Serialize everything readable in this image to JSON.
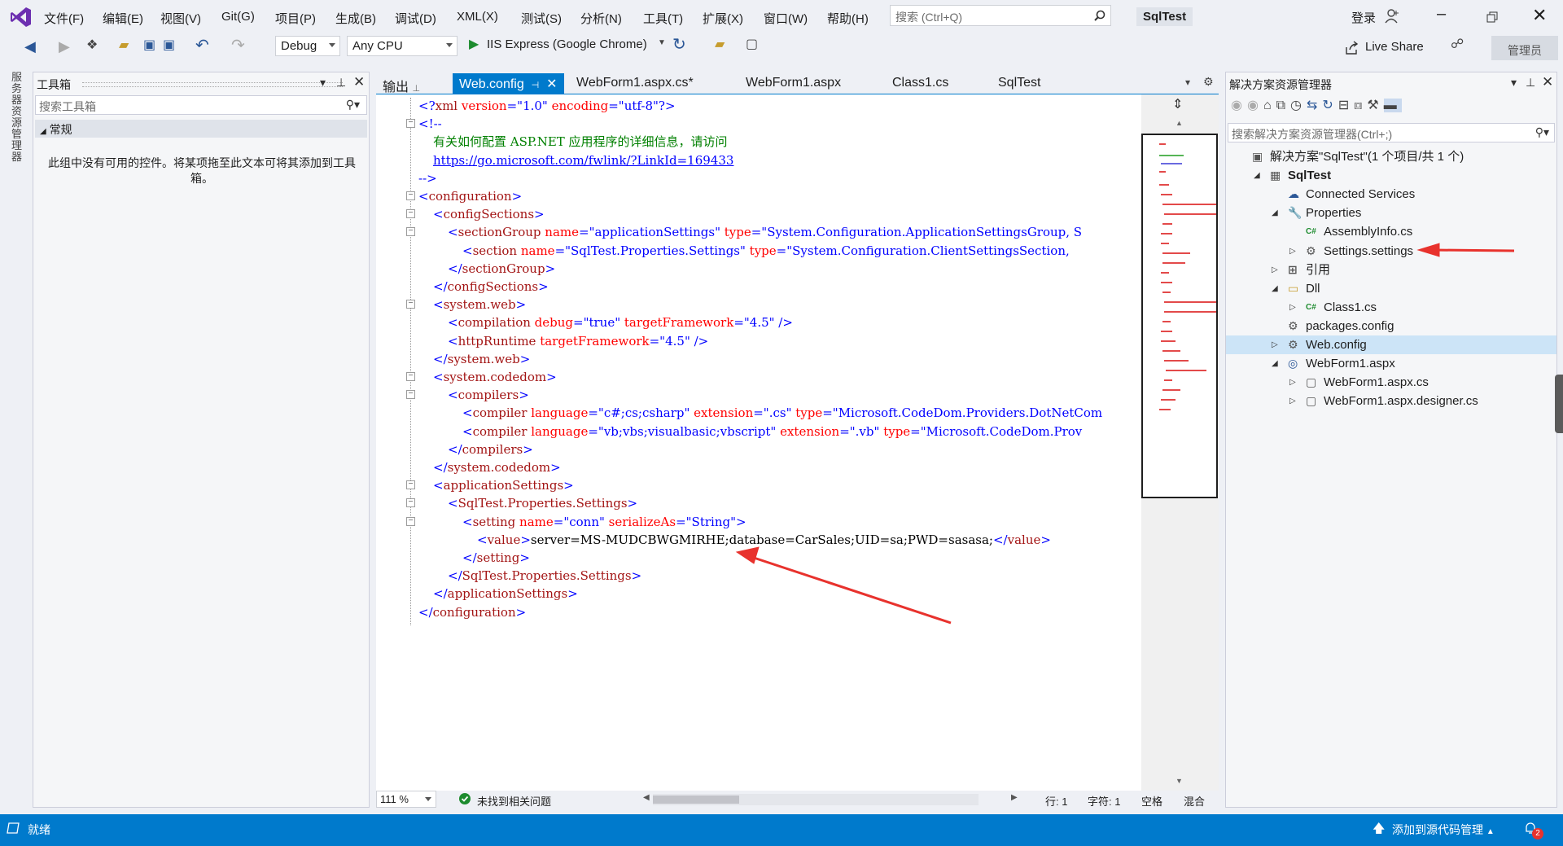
{
  "menu": {
    "items": [
      "文件(F)",
      "编辑(E)",
      "视图(V)",
      "Git(G)",
      "项目(P)",
      "生成(B)",
      "调试(D)",
      "XML(X)",
      "测试(S)",
      "分析(N)",
      "工具(T)",
      "扩展(X)",
      "窗口(W)",
      "帮助(H)"
    ],
    "search_placeholder": "搜索 (Ctrl+Q)",
    "solution_name": "SqlTest",
    "login": "登录"
  },
  "toolbar": {
    "config": "Debug",
    "platform": "Any CPU",
    "run": "IIS Express (Google Chrome)",
    "live_share": "Live Share",
    "admin": "管理员"
  },
  "left_tab": "服务器资源管理器",
  "toolbox": {
    "title": "工具箱",
    "search_placeholder": "搜索工具箱",
    "group": "常规",
    "empty_text": "此组中没有可用的控件。将某项拖至此文本可将其添加到工具箱。"
  },
  "tabs": [
    "输出",
    "Web.config",
    "WebForm1.aspx.cs*",
    "WebForm1.aspx",
    "Class1.cs",
    "SqlTest"
  ],
  "code_lines": [
    {
      "indent": 0,
      "parts": [
        [
          "t-p",
          "<?"
        ],
        [
          "t-tag",
          "xml"
        ],
        [
          "t-attr",
          " version"
        ],
        [
          "t-p",
          "=\""
        ],
        [
          "t-val",
          "1.0"
        ],
        [
          "t-p",
          "\""
        ],
        [
          "t-attr",
          " encoding"
        ],
        [
          "t-p",
          "=\""
        ],
        [
          "t-val",
          "utf-8"
        ],
        [
          "t-p",
          "\"?>"
        ]
      ]
    },
    {
      "indent": 0,
      "fold": "-",
      "parts": [
        [
          "t-p",
          "<!--"
        ]
      ]
    },
    {
      "indent": 1,
      "parts": [
        [
          "t-c",
          "有关如何配置 ASP.NET 应用程序的详细信息，请访问"
        ]
      ]
    },
    {
      "indent": 1,
      "parts": [
        [
          "t-link",
          "https://go.microsoft.com/fwlink/?LinkId=169433"
        ]
      ]
    },
    {
      "indent": 0,
      "parts": [
        [
          "t-p",
          "-->"
        ]
      ]
    },
    {
      "indent": 0,
      "fold": "-",
      "parts": [
        [
          "t-p",
          "<"
        ],
        [
          "t-tag",
          "configuration"
        ],
        [
          "t-p",
          ">"
        ]
      ]
    },
    {
      "indent": 1,
      "fold": "-",
      "parts": [
        [
          "t-p",
          "<"
        ],
        [
          "t-tag",
          "configSections"
        ],
        [
          "t-p",
          ">"
        ]
      ]
    },
    {
      "indent": 2,
      "fold": "-",
      "parts": [
        [
          "t-p",
          "<"
        ],
        [
          "t-tag",
          "sectionGroup"
        ],
        [
          "t-attr",
          " name"
        ],
        [
          "t-p",
          "=\""
        ],
        [
          "t-val",
          "applicationSettings"
        ],
        [
          "t-p",
          "\""
        ],
        [
          "t-attr",
          " type"
        ],
        [
          "t-p",
          "=\""
        ],
        [
          "t-val",
          "System.Configuration.ApplicationSettingsGroup, S"
        ]
      ]
    },
    {
      "indent": 3,
      "parts": [
        [
          "t-p",
          "<"
        ],
        [
          "t-tag",
          "section"
        ],
        [
          "t-attr",
          " name"
        ],
        [
          "t-p",
          "=\""
        ],
        [
          "t-val",
          "SqlTest.Properties.Settings"
        ],
        [
          "t-p",
          "\""
        ],
        [
          "t-attr",
          " type"
        ],
        [
          "t-p",
          "=\""
        ],
        [
          "t-val",
          "System.Configuration.ClientSettingsSection,"
        ]
      ]
    },
    {
      "indent": 2,
      "parts": [
        [
          "t-p",
          "</"
        ],
        [
          "t-tag",
          "sectionGroup"
        ],
        [
          "t-p",
          ">"
        ]
      ]
    },
    {
      "indent": 1,
      "parts": [
        [
          "t-p",
          "</"
        ],
        [
          "t-tag",
          "configSections"
        ],
        [
          "t-p",
          ">"
        ]
      ]
    },
    {
      "indent": 1,
      "fold": "-",
      "parts": [
        [
          "t-p",
          "<"
        ],
        [
          "t-tag",
          "system.web"
        ],
        [
          "t-p",
          ">"
        ]
      ]
    },
    {
      "indent": 2,
      "parts": [
        [
          "t-p",
          "<"
        ],
        [
          "t-tag",
          "compilation"
        ],
        [
          "t-attr",
          " debug"
        ],
        [
          "t-p",
          "=\""
        ],
        [
          "t-val",
          "true"
        ],
        [
          "t-p",
          "\""
        ],
        [
          "t-attr",
          " targetFramework"
        ],
        [
          "t-p",
          "=\""
        ],
        [
          "t-val",
          "4.5"
        ],
        [
          "t-p",
          "\" />"
        ]
      ]
    },
    {
      "indent": 2,
      "parts": [
        [
          "t-p",
          "<"
        ],
        [
          "t-tag",
          "httpRuntime"
        ],
        [
          "t-attr",
          " targetFramework"
        ],
        [
          "t-p",
          "=\""
        ],
        [
          "t-val",
          "4.5"
        ],
        [
          "t-p",
          "\" />"
        ]
      ]
    },
    {
      "indent": 1,
      "parts": [
        [
          "t-p",
          "</"
        ],
        [
          "t-tag",
          "system.web"
        ],
        [
          "t-p",
          ">"
        ]
      ]
    },
    {
      "indent": 1,
      "fold": "-",
      "parts": [
        [
          "t-p",
          "<"
        ],
        [
          "t-tag",
          "system.codedom"
        ],
        [
          "t-p",
          ">"
        ]
      ]
    },
    {
      "indent": 2,
      "fold": "-",
      "parts": [
        [
          "t-p",
          "<"
        ],
        [
          "t-tag",
          "compilers"
        ],
        [
          "t-p",
          ">"
        ]
      ]
    },
    {
      "indent": 3,
      "parts": [
        [
          "t-p",
          "<"
        ],
        [
          "t-tag",
          "compiler"
        ],
        [
          "t-attr",
          " language"
        ],
        [
          "t-p",
          "=\""
        ],
        [
          "t-val",
          "c#;cs;csharp"
        ],
        [
          "t-p",
          "\""
        ],
        [
          "t-attr",
          " extension"
        ],
        [
          "t-p",
          "=\""
        ],
        [
          "t-val",
          ".cs"
        ],
        [
          "t-p",
          "\""
        ],
        [
          "t-attr",
          " type"
        ],
        [
          "t-p",
          "=\""
        ],
        [
          "t-val",
          "Microsoft.CodeDom.Providers.DotNetCom"
        ]
      ]
    },
    {
      "indent": 3,
      "parts": [
        [
          "t-p",
          "<"
        ],
        [
          "t-tag",
          "compiler"
        ],
        [
          "t-attr",
          " language"
        ],
        [
          "t-p",
          "=\""
        ],
        [
          "t-val",
          "vb;vbs;visualbasic;vbscript"
        ],
        [
          "t-p",
          "\""
        ],
        [
          "t-attr",
          " extension"
        ],
        [
          "t-p",
          "=\""
        ],
        [
          "t-val",
          ".vb"
        ],
        [
          "t-p",
          "\""
        ],
        [
          "t-attr",
          " type"
        ],
        [
          "t-p",
          "=\""
        ],
        [
          "t-val",
          "Microsoft.CodeDom.Prov"
        ]
      ]
    },
    {
      "indent": 2,
      "parts": [
        [
          "t-p",
          "</"
        ],
        [
          "t-tag",
          "compilers"
        ],
        [
          "t-p",
          ">"
        ]
      ]
    },
    {
      "indent": 1,
      "parts": [
        [
          "t-p",
          "</"
        ],
        [
          "t-tag",
          "system.codedom"
        ],
        [
          "t-p",
          ">"
        ]
      ]
    },
    {
      "indent": 1,
      "fold": "-",
      "parts": [
        [
          "t-p",
          "<"
        ],
        [
          "t-tag",
          "applicationSettings"
        ],
        [
          "t-p",
          ">"
        ]
      ]
    },
    {
      "indent": 2,
      "fold": "-",
      "parts": [
        [
          "t-p",
          "<"
        ],
        [
          "t-tag",
          "SqlTest.Properties.Settings"
        ],
        [
          "t-p",
          ">"
        ]
      ]
    },
    {
      "indent": 3,
      "fold": "-",
      "parts": [
        [
          "t-p",
          "<"
        ],
        [
          "t-tag",
          "setting"
        ],
        [
          "t-attr",
          " name"
        ],
        [
          "t-p",
          "=\""
        ],
        [
          "t-val",
          "conn"
        ],
        [
          "t-p",
          "\""
        ],
        [
          "t-attr",
          " serializeAs"
        ],
        [
          "t-p",
          "=\""
        ],
        [
          "t-val",
          "String"
        ],
        [
          "t-p",
          "\">"
        ]
      ]
    },
    {
      "indent": 4,
      "parts": [
        [
          "t-p",
          "<"
        ],
        [
          "t-tag",
          "value"
        ],
        [
          "t-p",
          ">"
        ],
        [
          "t-txt",
          "server=MS-MUDCBWGMIRHE;database=CarSales;UID=sa;PWD=sasasa;"
        ],
        [
          "t-p",
          "</"
        ],
        [
          "t-tag",
          "value"
        ],
        [
          "t-p",
          ">"
        ]
      ]
    },
    {
      "indent": 3,
      "parts": [
        [
          "t-p",
          "</"
        ],
        [
          "t-tag",
          "setting"
        ],
        [
          "t-p",
          ">"
        ]
      ]
    },
    {
      "indent": 2,
      "parts": [
        [
          "t-p",
          "</"
        ],
        [
          "t-tag",
          "SqlTest.Properties.Settings"
        ],
        [
          "t-p",
          ">"
        ]
      ]
    },
    {
      "indent": 1,
      "parts": [
        [
          "t-p",
          "</"
        ],
        [
          "t-tag",
          "applicationSettings"
        ],
        [
          "t-p",
          ">"
        ]
      ]
    },
    {
      "indent": 0,
      "parts": [
        [
          "t-p",
          "</"
        ],
        [
          "t-tag",
          "configuration"
        ],
        [
          "t-p",
          ">"
        ]
      ]
    }
  ],
  "editor_status": {
    "zoom": "111 %",
    "issues": "未找到相关问题",
    "line": "行: 1",
    "char": "字符: 1",
    "spaces": "空格",
    "mixed": "混合"
  },
  "solution_explorer": {
    "title": "解决方案资源管理器",
    "search_placeholder": "搜索解决方案资源管理器(Ctrl+;)",
    "items": [
      {
        "label": "解决方案\"SqlTest\"(1 个项目/共 1 个)",
        "level": 0,
        "icon": "solution-icon",
        "expander": "",
        "bold": false
      },
      {
        "label": "SqlTest",
        "level": 1,
        "icon": "project-icon",
        "expander": "open",
        "bold": true
      },
      {
        "label": "Connected Services",
        "level": 2,
        "icon": "connected-services-icon",
        "expander": "",
        "bold": false
      },
      {
        "label": "Properties",
        "level": 2,
        "icon": "wrench-icon",
        "expander": "open",
        "bold": false
      },
      {
        "label": "AssemblyInfo.cs",
        "level": 3,
        "icon": "csharp-file-icon",
        "expander": "",
        "bold": false
      },
      {
        "label": "Settings.settings",
        "level": 3,
        "icon": "gear-icon",
        "expander": "closed",
        "bold": false
      },
      {
        "label": "引用",
        "level": 2,
        "icon": "references-icon",
        "expander": "closed",
        "bold": false
      },
      {
        "label": "Dll",
        "level": 2,
        "icon": "folder-icon",
        "expander": "open",
        "bold": false
      },
      {
        "label": "Class1.cs",
        "level": 3,
        "icon": "csharp-file-icon",
        "expander": "closed",
        "bold": false
      },
      {
        "label": "packages.config",
        "level": 2,
        "icon": "config-file-icon",
        "expander": "",
        "bold": false
      },
      {
        "label": "Web.config",
        "level": 2,
        "icon": "config-file-icon",
        "expander": "closed",
        "bold": false,
        "selected": true
      },
      {
        "label": "WebForm1.aspx",
        "level": 2,
        "icon": "web-form-icon",
        "expander": "open",
        "bold": false
      },
      {
        "label": "WebForm1.aspx.cs",
        "level": 3,
        "icon": "code-file-icon",
        "expander": "closed",
        "bold": false
      },
      {
        "label": "WebForm1.aspx.designer.cs",
        "level": 3,
        "icon": "code-file-icon",
        "expander": "closed",
        "bold": false
      }
    ]
  },
  "statusbar": {
    "ready": "就绪",
    "source_control": "添加到源代码管理",
    "notifications": "2"
  },
  "colors": {
    "accent": "#007acc",
    "annotation_arrow": "#e8322d"
  }
}
